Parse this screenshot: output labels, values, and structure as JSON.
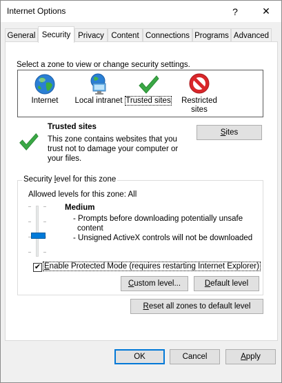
{
  "window": {
    "title": "Internet Options",
    "help_glyph": "?",
    "close_glyph": "✕"
  },
  "tabs": [
    {
      "label": "General"
    },
    {
      "label": "Security",
      "active": true
    },
    {
      "label": "Privacy"
    },
    {
      "label": "Content"
    },
    {
      "label": "Connections"
    },
    {
      "label": "Programs"
    },
    {
      "label": "Advanced"
    }
  ],
  "security": {
    "zone_prompt": "Select a zone to view or change security settings.",
    "zones": [
      {
        "label": "Internet",
        "icon": "globe-icon"
      },
      {
        "label": "Local intranet",
        "icon": "network-monitor-icon"
      },
      {
        "label": "Trusted sites",
        "icon": "checkmark-icon",
        "selected": true
      },
      {
        "label_line1": "Restricted",
        "label_line2": "sites",
        "icon": "no-entry-icon"
      }
    ],
    "selected_zone": {
      "title": "Trusted sites",
      "desc_line1": "This zone contains websites that you",
      "desc_line2": "trust not to damage your computer or",
      "desc_line3": "your files."
    },
    "sites_button": {
      "mnemonic": "S",
      "rest": "ites"
    },
    "level_group": {
      "title_pre": "Security ",
      "title_mnemonic": "l",
      "title_post": "evel for this zone",
      "allowed": "Allowed levels for this zone: All",
      "level_name": "Medium",
      "bullet1_line1": "- Prompts before downloading potentially unsafe",
      "bullet1_line2": "content",
      "bullet2": "- Unsigned ActiveX controls will not be downloaded",
      "slider_level": "Medium"
    },
    "protected_mode": {
      "mnemonic": "E",
      "rest": "nable Protected Mode (requires restarting Internet Explorer)",
      "checked": true,
      "check_glyph": "✔"
    },
    "custom_level": {
      "mnemonic": "C",
      "rest": "ustom level..."
    },
    "default_level": {
      "mnemonic": "D",
      "rest": "efault level"
    },
    "reset_all": {
      "mnemonic": "R",
      "rest": "eset all zones to default level"
    }
  },
  "footer": {
    "ok": "OK",
    "cancel": "Cancel",
    "apply_mnemonic": "A",
    "apply_rest": "pply"
  },
  "colors": {
    "accent_blue": "#0078d7",
    "check_green": "#3aa845",
    "restricted_red": "#d9262a"
  }
}
